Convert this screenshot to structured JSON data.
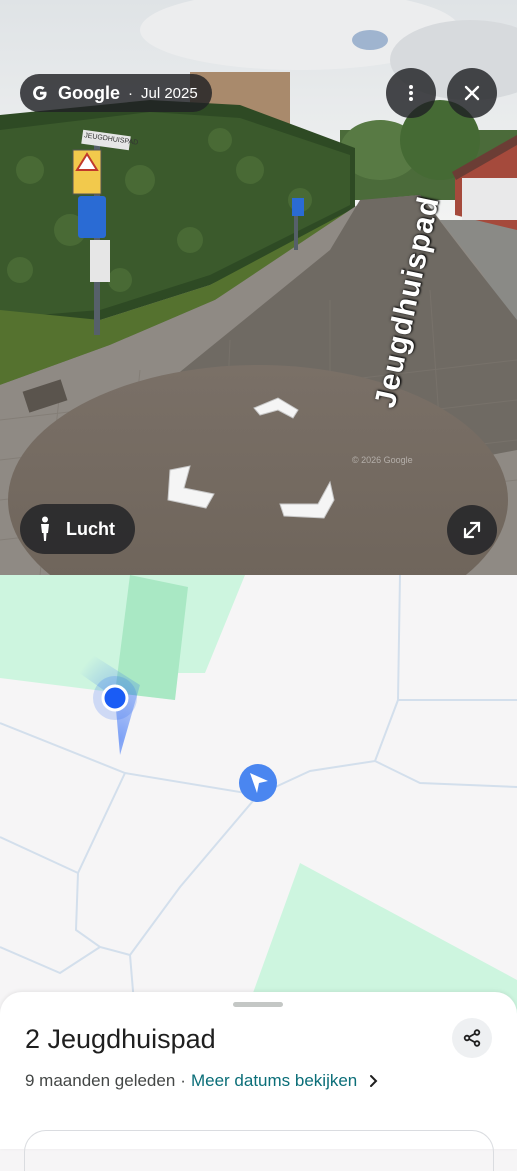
{
  "streetview": {
    "brand": "Google",
    "separator": "·",
    "capture_date": "Jul 2025",
    "mode_label": "Lucht",
    "copyright": "© 2026 Google",
    "street_sign": "JEUGDHUISPAD",
    "road_label": "Jeugdhuispad",
    "icons": [
      "google-g-icon",
      "more-vert-icon",
      "close-icon",
      "pedestrian-icon",
      "expand-icon"
    ]
  },
  "map": {
    "colors": {
      "park": "#cdf5df",
      "park_dark": "#a9e8c4",
      "location_dot": "#1a5cf5",
      "navigation_marker": "#4a86f0"
    }
  },
  "sheet": {
    "title": "2 Jeugdhuispad",
    "date_relative": "9 maanden geleden",
    "separator": "·",
    "more_dates_link": "Meer datums bekijken",
    "icons": [
      "share-icon",
      "chevron-right-icon"
    ]
  }
}
